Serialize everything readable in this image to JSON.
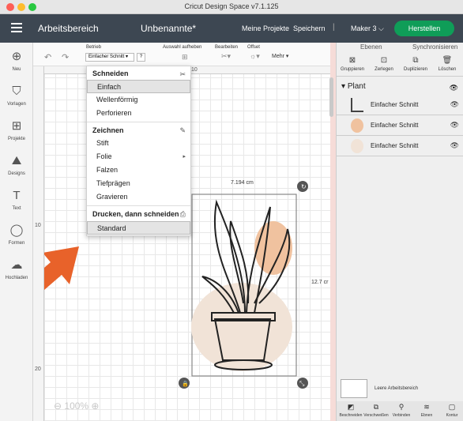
{
  "window": {
    "title": "Cricut Design Space  v7.1.125",
    "traffic_colors": [
      "#fe5f57",
      "#febc2e",
      "#28c840"
    ]
  },
  "appbar": {
    "workspace": "Arbeitsbereich",
    "project": "Unbenannte*",
    "my_projects": "Meine Projekte",
    "save": "Speichern",
    "separator": "|",
    "machine": "Maker 3",
    "make": "Herstellen",
    "accent": "#0f9d58"
  },
  "left_nav": [
    {
      "icon": "plus-icon",
      "glyph": "⊕",
      "label": "Neu"
    },
    {
      "icon": "shirt-icon",
      "glyph": "👕",
      "label": "Vorlagen"
    },
    {
      "icon": "projects-icon",
      "glyph": "⊞",
      "label": "Projekte"
    },
    {
      "icon": "image-icon",
      "glyph": "🖼",
      "label": "Designs"
    },
    {
      "icon": "text-icon",
      "glyph": "T",
      "label": "Text"
    },
    {
      "icon": "shapes-icon",
      "glyph": "◯",
      "label": "Formen"
    },
    {
      "icon": "upload-icon",
      "glyph": "☁",
      "label": "Hochladen"
    }
  ],
  "toolbar": {
    "betrieb": "Betrieb",
    "operation_value": "Einfacher Schnitt",
    "q": "?",
    "ungroup": "Auswahl aufheben",
    "edit": "Bearbeiten",
    "offset": "Offset",
    "more": "Mehr ▾"
  },
  "canvas": {
    "ruler_10": "10",
    "ruler_left_10": "10",
    "ruler_left_20": "20",
    "width_label": "7.194 cm",
    "height_label": "12.7 cr",
    "zoom": "100%"
  },
  "menu": {
    "cut_header": "Schneiden",
    "cut_items": [
      "Einfach",
      "Wellenförmig",
      "Perforieren"
    ],
    "selected": "Einfach",
    "draw_header": "Zeichnen",
    "draw_items": [
      "Stift",
      "Folie",
      "Falzen",
      "Tiefprägen",
      "Gravieren"
    ],
    "print_header": "Drucken, dann schneiden",
    "print_items": [
      "Standard"
    ]
  },
  "right_panel": {
    "tab_layers": "Ebenen",
    "tab_sync": "Synchronisieren",
    "tools": [
      "Gruppieren",
      "Zerlegen",
      "Duplizieren",
      "Löschen"
    ],
    "group_name": "Plant",
    "layers": [
      "Einfacher Schnitt",
      "Einfacher Schnitt",
      "Einfacher Schnitt"
    ],
    "blank_canvas": "Leere Arbeitsbereich",
    "bottom_tools": [
      "Beschneiden",
      "Verschweißen",
      "Verbinden",
      "Ebnen",
      "Kontur"
    ]
  }
}
